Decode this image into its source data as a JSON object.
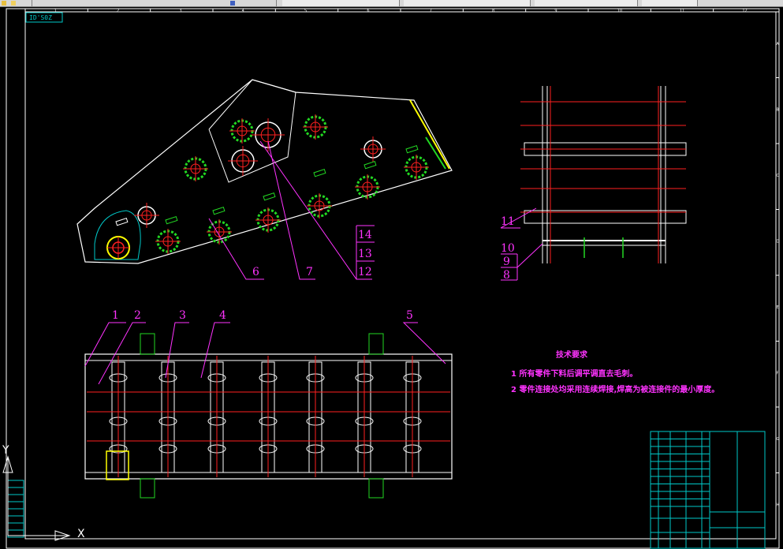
{
  "toolbar": {
    "segments": [
      {
        "label": "",
        "id": "icon-strip"
      },
      {
        "label": "",
        "id": "layer-combo"
      },
      {
        "label": "",
        "id": "style-combo-1"
      },
      {
        "label": "",
        "id": "style-combo-2"
      },
      {
        "label": "",
        "id": "style-combo-3"
      }
    ]
  },
  "drawing": {
    "stamp": "ID'S0Z",
    "grid_top": [
      "1",
      "2",
      "3",
      "4",
      "5",
      "6",
      "7",
      "8",
      "9",
      "10",
      "11",
      "12"
    ],
    "grid_right": [
      "A",
      "B",
      "C",
      "D",
      "E",
      "F",
      "G",
      "H"
    ],
    "balloons": {
      "b1": "1",
      "b2": "2",
      "b3": "3",
      "b4": "4",
      "b5": "5",
      "b6": "6",
      "b7": "7",
      "b8": "8",
      "b9": "9",
      "b10": "10",
      "b11": "11",
      "b12": "12",
      "b13": "13",
      "b14": "14"
    },
    "notes": {
      "title": "技术要求",
      "line1": "1 所有零件下料后调平调直去毛刺。",
      "line2": "2 零件连接处均采用连续焊接,焊高为被连接件的最小厚度。"
    },
    "ucs": {
      "x": "X",
      "y": "Y"
    }
  },
  "colors": {
    "background": "#000000",
    "outline": "#ffffff",
    "bolt": "#22d822",
    "center": "#ff2020",
    "leader": "#ff33ff",
    "frame": "#00c8c8",
    "note": "#ff33ff",
    "yellow": "#ffff00"
  }
}
